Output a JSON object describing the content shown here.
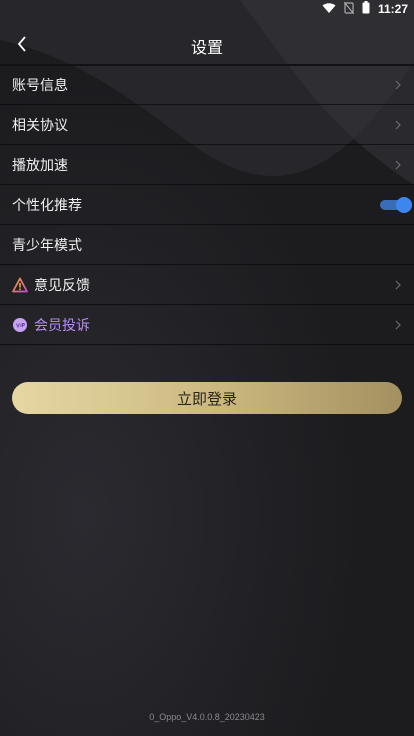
{
  "status_bar": {
    "time": "11:27",
    "icons": [
      "wifi-icon",
      "no-sim-icon",
      "battery-icon"
    ]
  },
  "header": {
    "title": "设置",
    "back_icon": "chevron-left-icon"
  },
  "menu": {
    "items": [
      {
        "label": "账号信息",
        "trailing": "chevron-right-icon"
      },
      {
        "label": "相关协议",
        "trailing": "chevron-right-icon"
      },
      {
        "label": "播放加速",
        "trailing": "chevron-right-icon"
      },
      {
        "label": "个性化推荐",
        "trailing": "toggle",
        "toggle_on": true
      },
      {
        "label": "青少年模式",
        "trailing": "none"
      },
      {
        "label": "意见反馈",
        "leading_icon": "warning-triangle-icon",
        "trailing": "chevron-right-icon"
      },
      {
        "label": "会员投诉",
        "leading_icon": "vip-badge-icon",
        "trailing": "chevron-right-icon"
      }
    ]
  },
  "login_button": {
    "label": "立即登录"
  },
  "footer": {
    "version": "0_Oppo_V4.0.0.8_20230423"
  },
  "colors": {
    "accent_toggle": "#3d86f0",
    "vip_text": "#b78ef0",
    "login_gradient_start": "#e6d7a3",
    "login_gradient_end": "#a39060",
    "background": "#1c1c1f"
  }
}
